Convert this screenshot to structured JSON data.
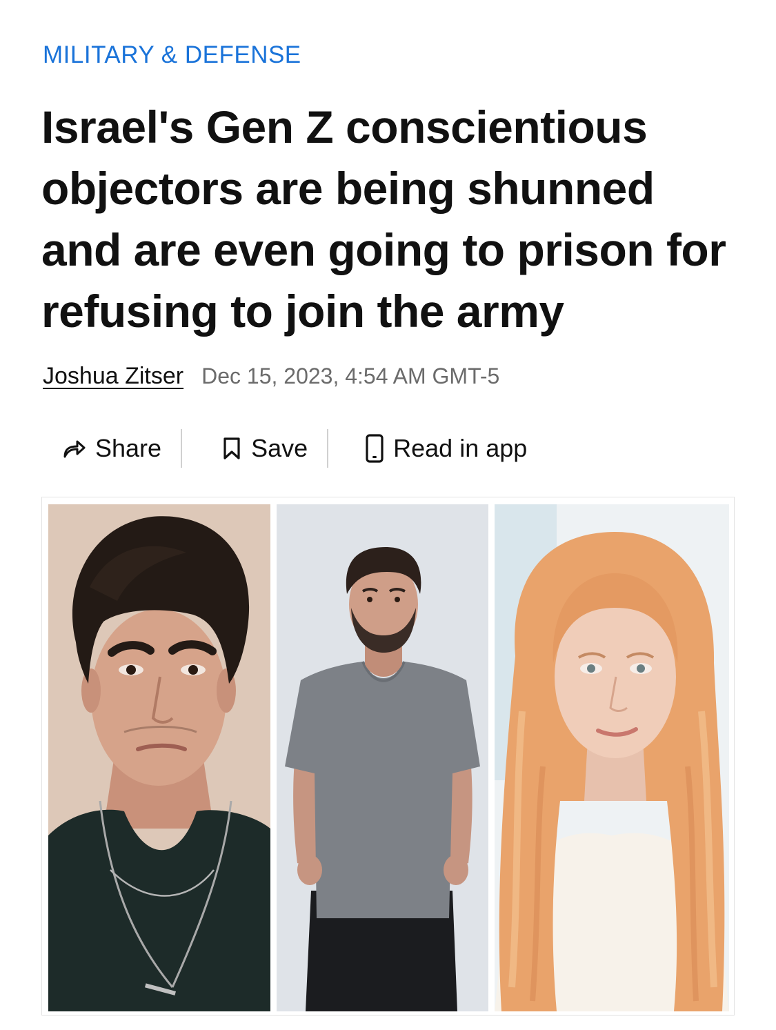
{
  "article": {
    "category": "MILITARY & DEFENSE",
    "headline": "Israel's Gen Z conscientious objectors are being shunned and are even going to prison for refusing to join the army",
    "author": "Joshua Zitser",
    "date": "Dec 15, 2023, 4:54 AM GMT-5"
  },
  "actions": {
    "share": {
      "label": "Share",
      "icon": "share-arrow-icon"
    },
    "save": {
      "label": "Save",
      "icon": "bookmark-icon"
    },
    "read_in_app": {
      "label": "Read in app",
      "icon": "phone-icon"
    }
  },
  "colors": {
    "category": "#1a73d9",
    "headline": "#111111",
    "date": "#6b6b6b"
  },
  "photos": [
    "portrait-young-man-dark-hair",
    "portrait-young-man-grey-tshirt",
    "portrait-young-woman-red-hair"
  ]
}
